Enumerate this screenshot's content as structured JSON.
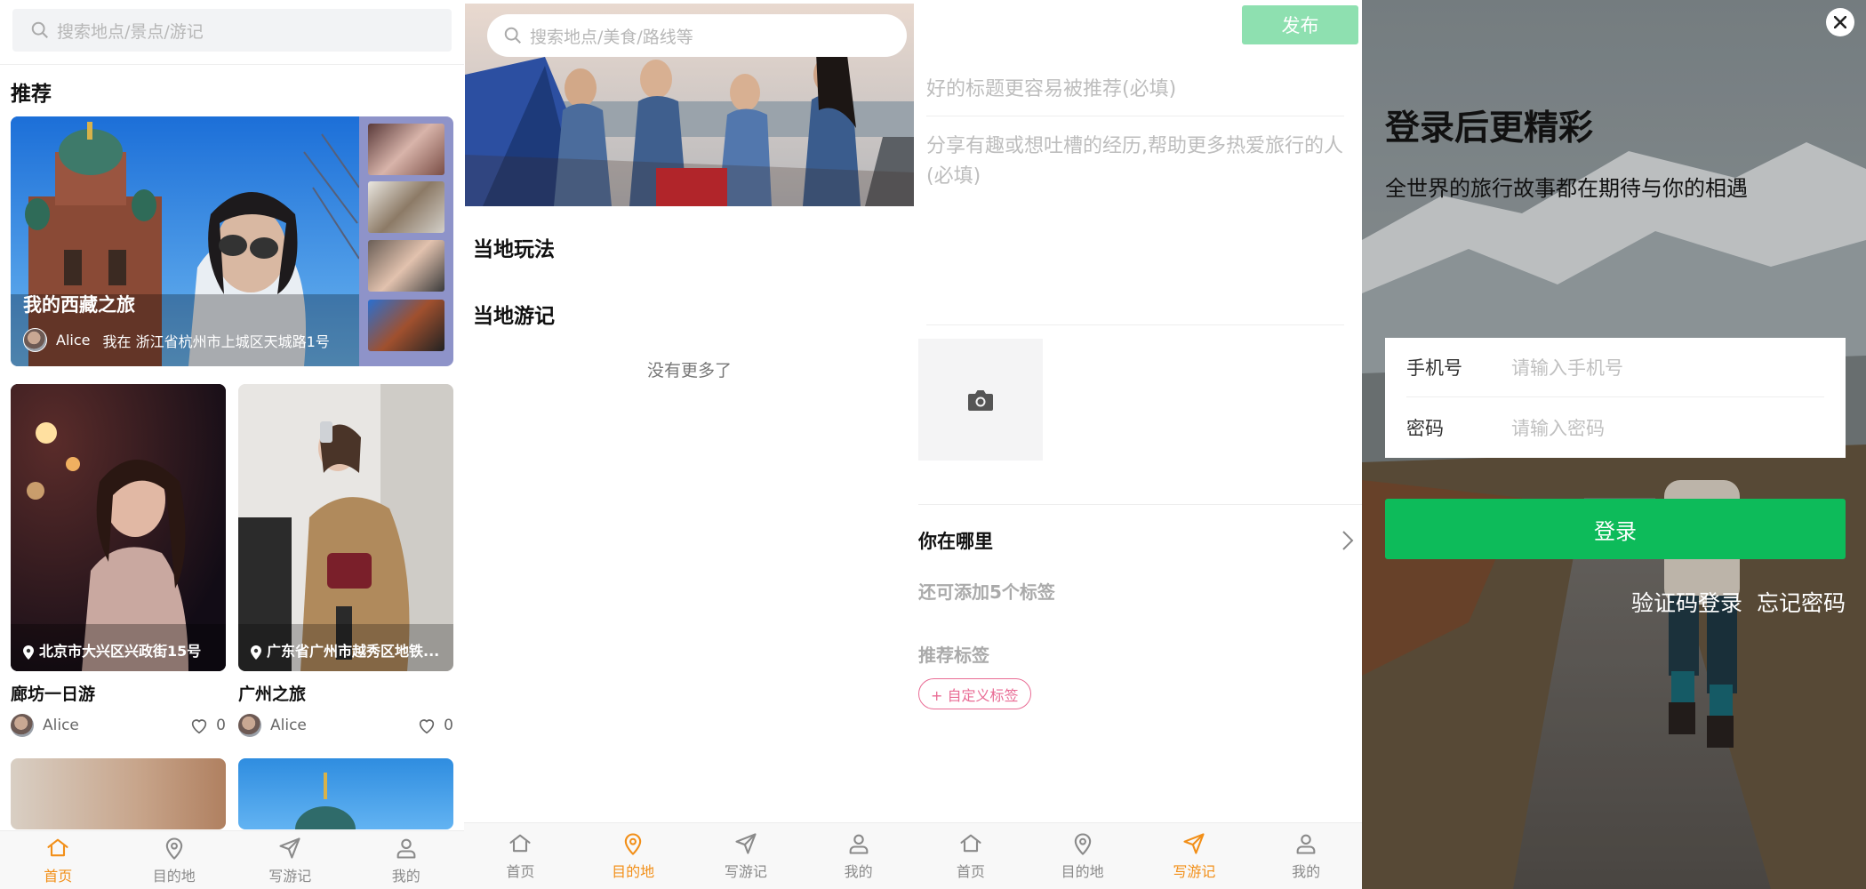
{
  "home": {
    "search_placeholder": "搜索地点/景点/游记",
    "section_title": "推荐",
    "hero": {
      "title": "我的西藏之旅",
      "author": "Alice",
      "location": "我在 浙江省杭州市上城区天城路1号"
    },
    "cards": [
      {
        "location": "北京市大兴区兴政街15号",
        "title": "廊坊一日游",
        "author": "Alice",
        "likes": "0"
      },
      {
        "location": "广东省广州市越秀区地铁...",
        "title": "广州之旅",
        "author": "Alice",
        "likes": "0"
      }
    ]
  },
  "destination": {
    "search_placeholder": "搜索地点/美食/路线等",
    "section_play": "当地玩法",
    "section_notes": "当地游记",
    "no_more": "没有更多了"
  },
  "write": {
    "publish_label": "发布",
    "title_placeholder": "好的标题更容易被推荐(必填)",
    "content_placeholder": "分享有趣或想吐槽的经历,帮助更多热爱旅行的人(必填)",
    "where_label": "你在哪里",
    "tag_hint": "还可添加5个标签",
    "recommend_tags_label": "推荐标签",
    "custom_tag_label": "+ 自定义标签"
  },
  "tabs": [
    "首页",
    "目的地",
    "写游记",
    "我的"
  ],
  "login": {
    "title": "登录后更精彩",
    "subtitle": "全世界的旅行故事都在期待与你的相遇",
    "phone_label": "手机号",
    "phone_placeholder": "请输入手机号",
    "password_label": "密码",
    "password_placeholder": "请输入密码",
    "login_button": "登录",
    "sms_login": "验证码登录",
    "forgot_password": "忘记密码"
  },
  "colors": {
    "accent_orange": "#f28f18",
    "publish_green": "#8ee0b0",
    "login_green": "#0dbb5a",
    "tag_pink": "#e96b94"
  }
}
